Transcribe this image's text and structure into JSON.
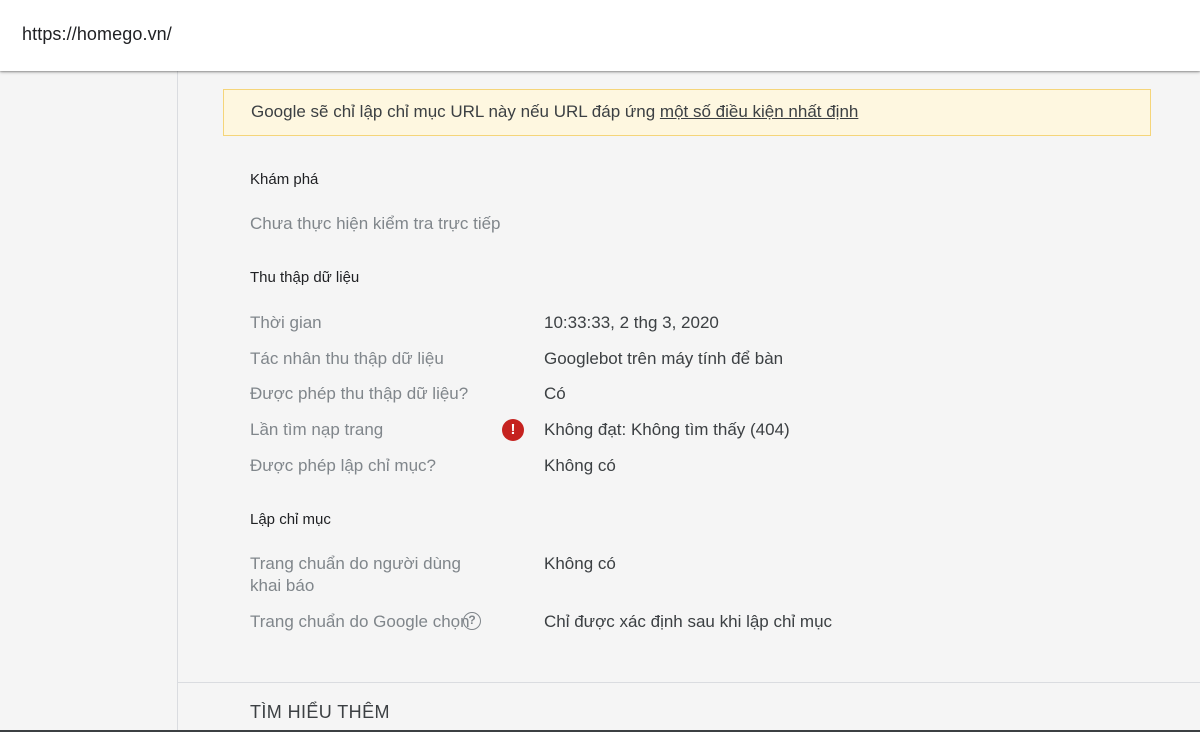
{
  "header": {
    "url": "https://homego.vn/"
  },
  "notice": {
    "text": "Google sẽ chỉ lập chỉ mục URL này nếu URL đáp ứng ",
    "link": "một số điều kiện nhất định"
  },
  "discovery": {
    "title": "Khám phá",
    "status": "Chưa thực hiện kiểm tra trực tiếp"
  },
  "crawl": {
    "title": "Thu thập dữ liệu",
    "rows": [
      {
        "label": "Thời gian",
        "value": "10:33:33, 2 thg 3, 2020"
      },
      {
        "label": "Tác nhân thu thập dữ liệu",
        "value": "Googlebot trên máy tính để bàn"
      },
      {
        "label": "Được phép thu thập dữ liệu?",
        "value": "Có"
      },
      {
        "label": "Lần tìm nạp trang",
        "value": "Không đạt: Không tìm thấy (404)",
        "icon": "error-icon"
      },
      {
        "label": "Được phép lập chỉ mục?",
        "value": "Không có"
      }
    ]
  },
  "indexing": {
    "title": "Lập chỉ mục",
    "rows": [
      {
        "label": "Trang chuẩn do người dùng khai báo",
        "value": "Không có"
      },
      {
        "label": "Trang chuẩn do Google chọn",
        "value": "Chỉ được xác định sau khi lập chỉ mục",
        "icon": "help-icon"
      }
    ]
  },
  "footer": {
    "learn_more": "TÌM HIỂU THÊM"
  },
  "icons": {
    "error_glyph": "!",
    "help_glyph": "?"
  },
  "colors": {
    "error": "#c5221f",
    "notice_bg": "#fef7e0",
    "notice_border": "#f5d57a"
  }
}
